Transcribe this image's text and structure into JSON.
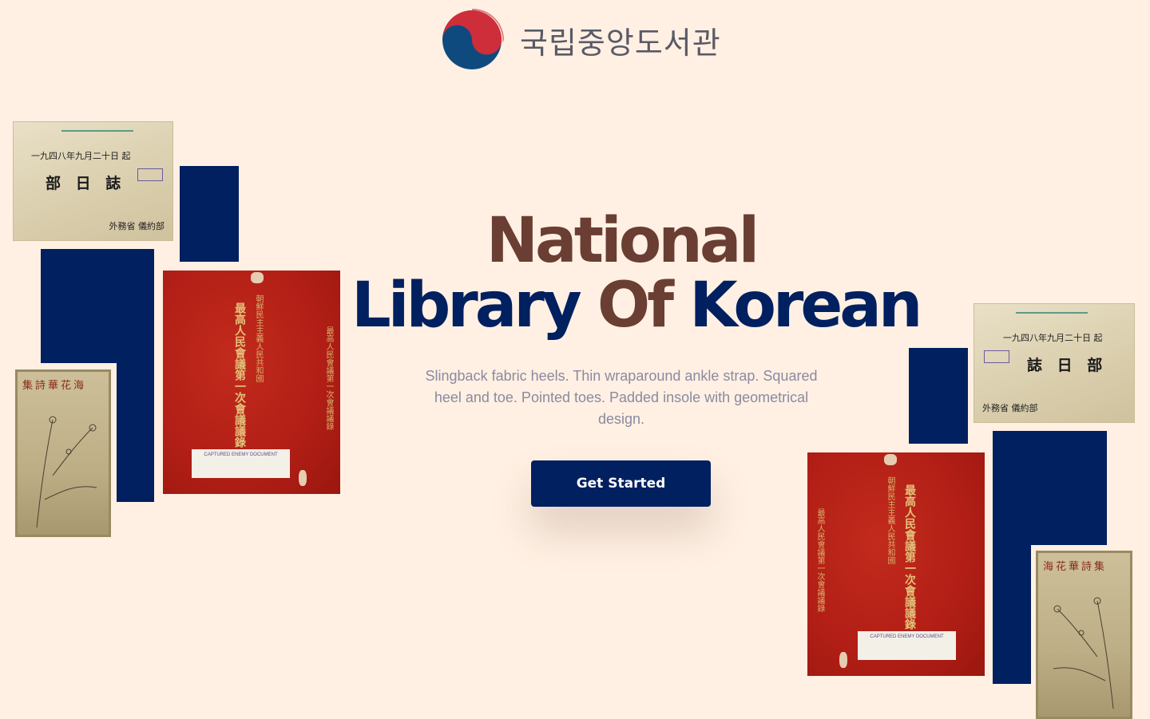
{
  "header": {
    "logo_text": "국립중앙도서관",
    "logo_colors": {
      "red": "#cd2e3a",
      "blue": "#0f4a7f"
    }
  },
  "hero": {
    "title_line1": "National",
    "title_line2_part1": "Library",
    "title_line2_part2": "Of",
    "title_line2_part3": "Korean",
    "subtitle": "Slingback fabric heels. Thin wraparound ankle strap. Squared heel and toe. Pointed toes. Padded insole with geometrical design.",
    "cta_label": "Get Started"
  },
  "documents": {
    "top_left": {
      "date_line": "一九四八年九月二十日 起",
      "title": "部 日 誌",
      "footer": "外務省 儀約部"
    },
    "red_left": {
      "col1": "最高人民會議第一次會議議錄",
      "col2": "朝鮮民主主義人民共和國",
      "label": "CAPTURED ENEMY DOCUMENT"
    },
    "sketch_left": {
      "title": "集詩華花海"
    },
    "top_right": {
      "date_line": "一九四八年九月二十日 起",
      "title": "誌 日 部",
      "footer": "外務省 儀約部"
    },
    "red_right": {
      "col1": "最高人民會議第一次會議議錄",
      "col2": "朝鮮民主主義人民共和國",
      "label": "CAPTURED ENEMY DOCUMENT"
    },
    "sketch_right": {
      "title": "海花華詩集"
    }
  },
  "colors": {
    "background": "#fff0e3",
    "navy": "#002060",
    "brown": "#6a3e32",
    "muted_text": "#8a8aa0"
  }
}
